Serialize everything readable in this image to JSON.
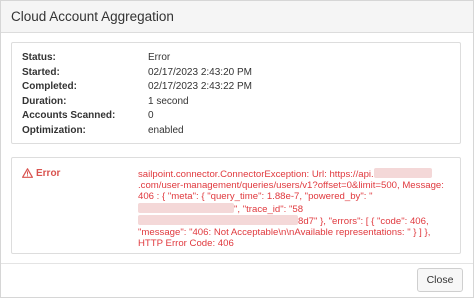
{
  "dialog": {
    "title": "Cloud Account Aggregation"
  },
  "details": [
    {
      "label": "Status:",
      "value": "Error"
    },
    {
      "label": "Started:",
      "value": "02/17/2023 2:43:20 PM"
    },
    {
      "label": "Completed:",
      "value": "02/17/2023 2:43:22 PM"
    },
    {
      "label": "Duration:",
      "value": "1 second"
    },
    {
      "label": "Accounts Scanned:",
      "value": "0"
    },
    {
      "label": "Optimization:",
      "value": "enabled"
    }
  ],
  "error": {
    "heading": "Error",
    "icon": "warning-triangle-icon",
    "message_parts": {
      "p1": "sailpoint.connector.ConnectorException: Url: https://api.",
      "p2": ".com/user-management/queries/users/v1?offset=0&limit=500, Message: 406 : { \"meta\": { \"query_time\": 1.88e-7, \"powered_by\": \"",
      "p3": "\", \"trace_id\": \"58",
      "p4": "8d7\" }, \"errors\": [ { \"code\": 406, \"message\": \"406: Not Acceptable\\n\\nAvailable representations: \" } ] }, HTTP Error Code: 406"
    }
  },
  "footer": {
    "close_label": "Close"
  },
  "colors": {
    "error": "#e0393e",
    "header_bg": "#f5f5f5",
    "border": "#dddddd"
  }
}
